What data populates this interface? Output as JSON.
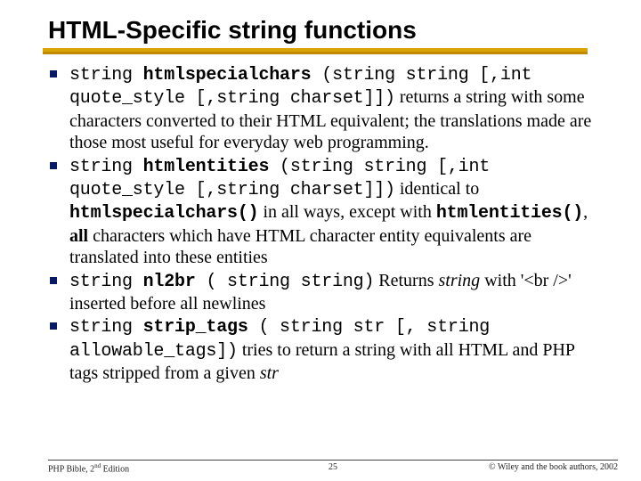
{
  "title": "HTML-Specific string functions",
  "items": [
    {
      "sig_pre": "string ",
      "sig_name": "htmlspecialchars",
      "sig_post": " (string string [,int quote_style [,string charset]])",
      "desc_plain": " returns a string with some characters converted to their HTML equivalent; the translations made are those most useful for everyday web programming.",
      "extra_html": ""
    },
    {
      "sig_pre": "string ",
      "sig_name": "htmlentities",
      "sig_post": " (string string [,int quote_style [,string charset]])",
      "desc_plain": " identical to ",
      "extra_html": "<span class=\"mono b\">htmlspecialchars()</span> in all ways, except with <span class=\"mono b\">htmlentities()</span>, <span class=\"b\">all</span> characters which have HTML character entity equivalents are translated into these entities"
    },
    {
      "sig_pre": "string ",
      "sig_name": "nl2br",
      "sig_post": " ( string string)",
      "desc_plain": " Returns ",
      "extra_html": "<span class=\"i\">string</span> with '&lt;br /&gt;' inserted before all newlines"
    },
    {
      "sig_pre": "string ",
      "sig_name": "strip_tags",
      "sig_post": " ( string str [, string allowable_tags])",
      "desc_plain": " tries to return a string with all HTML and PHP tags stripped from a given ",
      "extra_html": "<span class=\"i\">str</span>"
    }
  ],
  "footer": {
    "left_pre": "PHP Bible, 2",
    "left_sup": "nd",
    "left_post": " Edition",
    "page": "25",
    "right": "© Wiley and the book authors, 2002"
  }
}
